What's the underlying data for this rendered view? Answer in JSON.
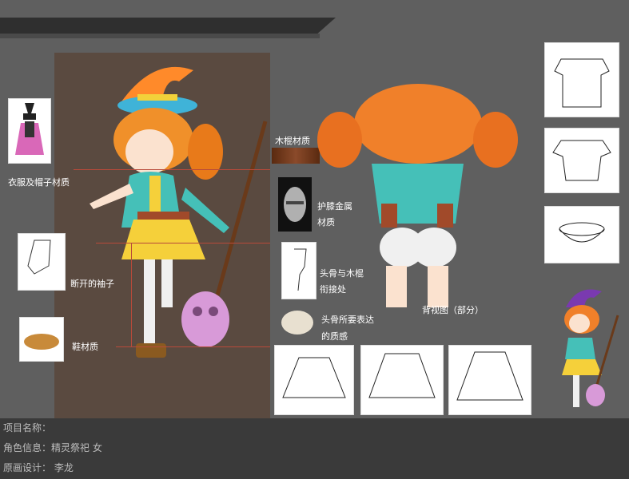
{
  "labels": {
    "clothes_hat_material": "衣服及帽子材质",
    "broken_sleeve": "断开的袖子",
    "shoe_material": "鞋材质",
    "wood_stick_material": "木棍材质",
    "leg_guard_metal_1": "护膝金属",
    "leg_guard_metal_2": "材质",
    "skull_stick_joint_1": "头骨与木棍",
    "skull_stick_joint_2": "衔接处",
    "skull_texture_1": "头骨所要表达",
    "skull_texture_2": "的质感",
    "back_view": "背视图（部分）"
  },
  "footer": {
    "project_name": "项目名称：",
    "character_info": "角色信息：精灵祭祀 女",
    "concept_design": "原画设计：  李龙"
  },
  "colors": {
    "background": "#5f5f5f",
    "panel_brown": "#5a4a40",
    "accent_red_line": "#b84a3a",
    "hair_orange": "#f0802a",
    "top_teal": "#45c0b8",
    "skirt_yellow": "#f5d03a"
  }
}
